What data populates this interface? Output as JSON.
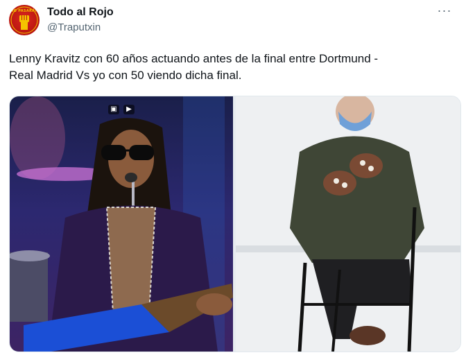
{
  "header": {
    "display_name": "Todo al Rojo",
    "handle": "@Traputxin",
    "more_label": "···",
    "avatar_text": "NO PASARÁN"
  },
  "tweet": {
    "text": "Lenny Kravitz con 60 años actuando antes de la final entre Dortmund -\nReal Madrid Vs yo con 50 viendo dicha final."
  },
  "media": {
    "icons": [
      "image-icon",
      "play-icon"
    ]
  },
  "colors": {
    "avatar_red": "#c41a12",
    "avatar_gold": "#f5c400",
    "handle_gray": "#536471"
  }
}
